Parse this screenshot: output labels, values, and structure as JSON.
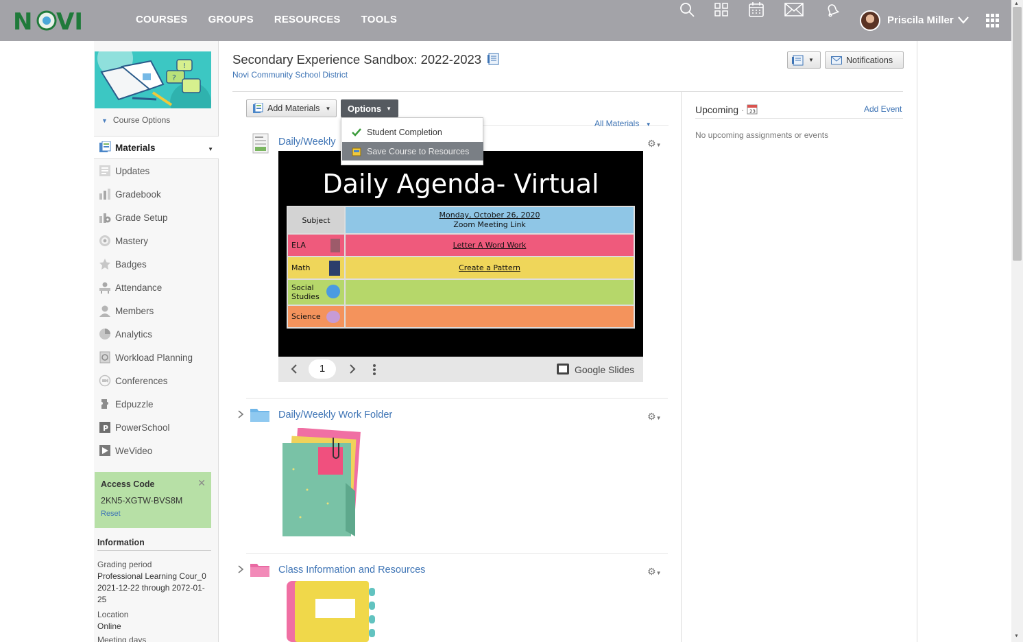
{
  "topbar": {
    "logo": "NOVI",
    "nav": [
      "COURSES",
      "GROUPS",
      "RESOURCES",
      "TOOLS"
    ],
    "icons": [
      "search-icon",
      "grid-icon",
      "calendar-icon",
      "mail-icon",
      "bell-icon"
    ],
    "user_name": "Priscila Miller"
  },
  "sidebar": {
    "course_options": "Course Options",
    "items": [
      {
        "label": "Materials",
        "icon": "materials-icon"
      },
      {
        "label": "Updates",
        "icon": "updates-icon"
      },
      {
        "label": "Gradebook",
        "icon": "gradebook-icon"
      },
      {
        "label": "Grade Setup",
        "icon": "grade-setup-icon"
      },
      {
        "label": "Mastery",
        "icon": "mastery-icon"
      },
      {
        "label": "Badges",
        "icon": "badges-icon"
      },
      {
        "label": "Attendance",
        "icon": "attendance-icon"
      },
      {
        "label": "Members",
        "icon": "members-icon"
      },
      {
        "label": "Analytics",
        "icon": "analytics-icon"
      },
      {
        "label": "Workload Planning",
        "icon": "workload-icon"
      },
      {
        "label": "Conferences",
        "icon": "conferences-icon"
      },
      {
        "label": "Edpuzzle",
        "icon": "edpuzzle-icon"
      },
      {
        "label": "PowerSchool",
        "icon": "powerschool-icon"
      },
      {
        "label": "WeVideo",
        "icon": "wevideo-icon"
      }
    ],
    "access_code": {
      "title": "Access Code",
      "code": "2KN5-XGTW-BVS8M",
      "reset": "Reset"
    },
    "information": {
      "title": "Information",
      "grading_period_label": "Grading period",
      "grading_period_value": "Professional Learning Cour_0 2021-12-22 through 2072-01-25",
      "location_label": "Location",
      "location_value": "Online",
      "meeting_days_label": "Meeting days"
    }
  },
  "main": {
    "course_title": "Secondary Experience Sandbox: 2022-2023",
    "district": "Novi Community School District",
    "notifications": "Notifications",
    "add_materials": "Add Materials",
    "options": "Options",
    "all_materials": "All Materials",
    "options_menu": [
      "Student Completion",
      "Save Course to Resources"
    ],
    "items": [
      {
        "title": "Daily/Weekly"
      },
      {
        "title": "Daily/Weekly Work Folder"
      },
      {
        "title": "Class Information and Resources"
      }
    ],
    "slide": {
      "title": "Daily Agenda- Virtual",
      "header_subject": "Subject",
      "header_date": "Monday, October 26, 2020",
      "header_link": "Zoom Meeting Link",
      "rows": [
        {
          "subject": "ELA",
          "value": "Letter A Word Work",
          "color": "#ef5a7c"
        },
        {
          "subject": "Math",
          "value": "Create a Pattern",
          "color": "#efd65a"
        },
        {
          "subject": "Social Studies",
          "value": "",
          "color": "#b6d76a"
        },
        {
          "subject": "Science",
          "value": "",
          "color": "#f4935c"
        }
      ],
      "page": "1",
      "viewer": "Google Slides"
    }
  },
  "upcoming": {
    "title": "Upcoming",
    "add_event": "Add Event",
    "empty": "No upcoming assignments or events"
  }
}
